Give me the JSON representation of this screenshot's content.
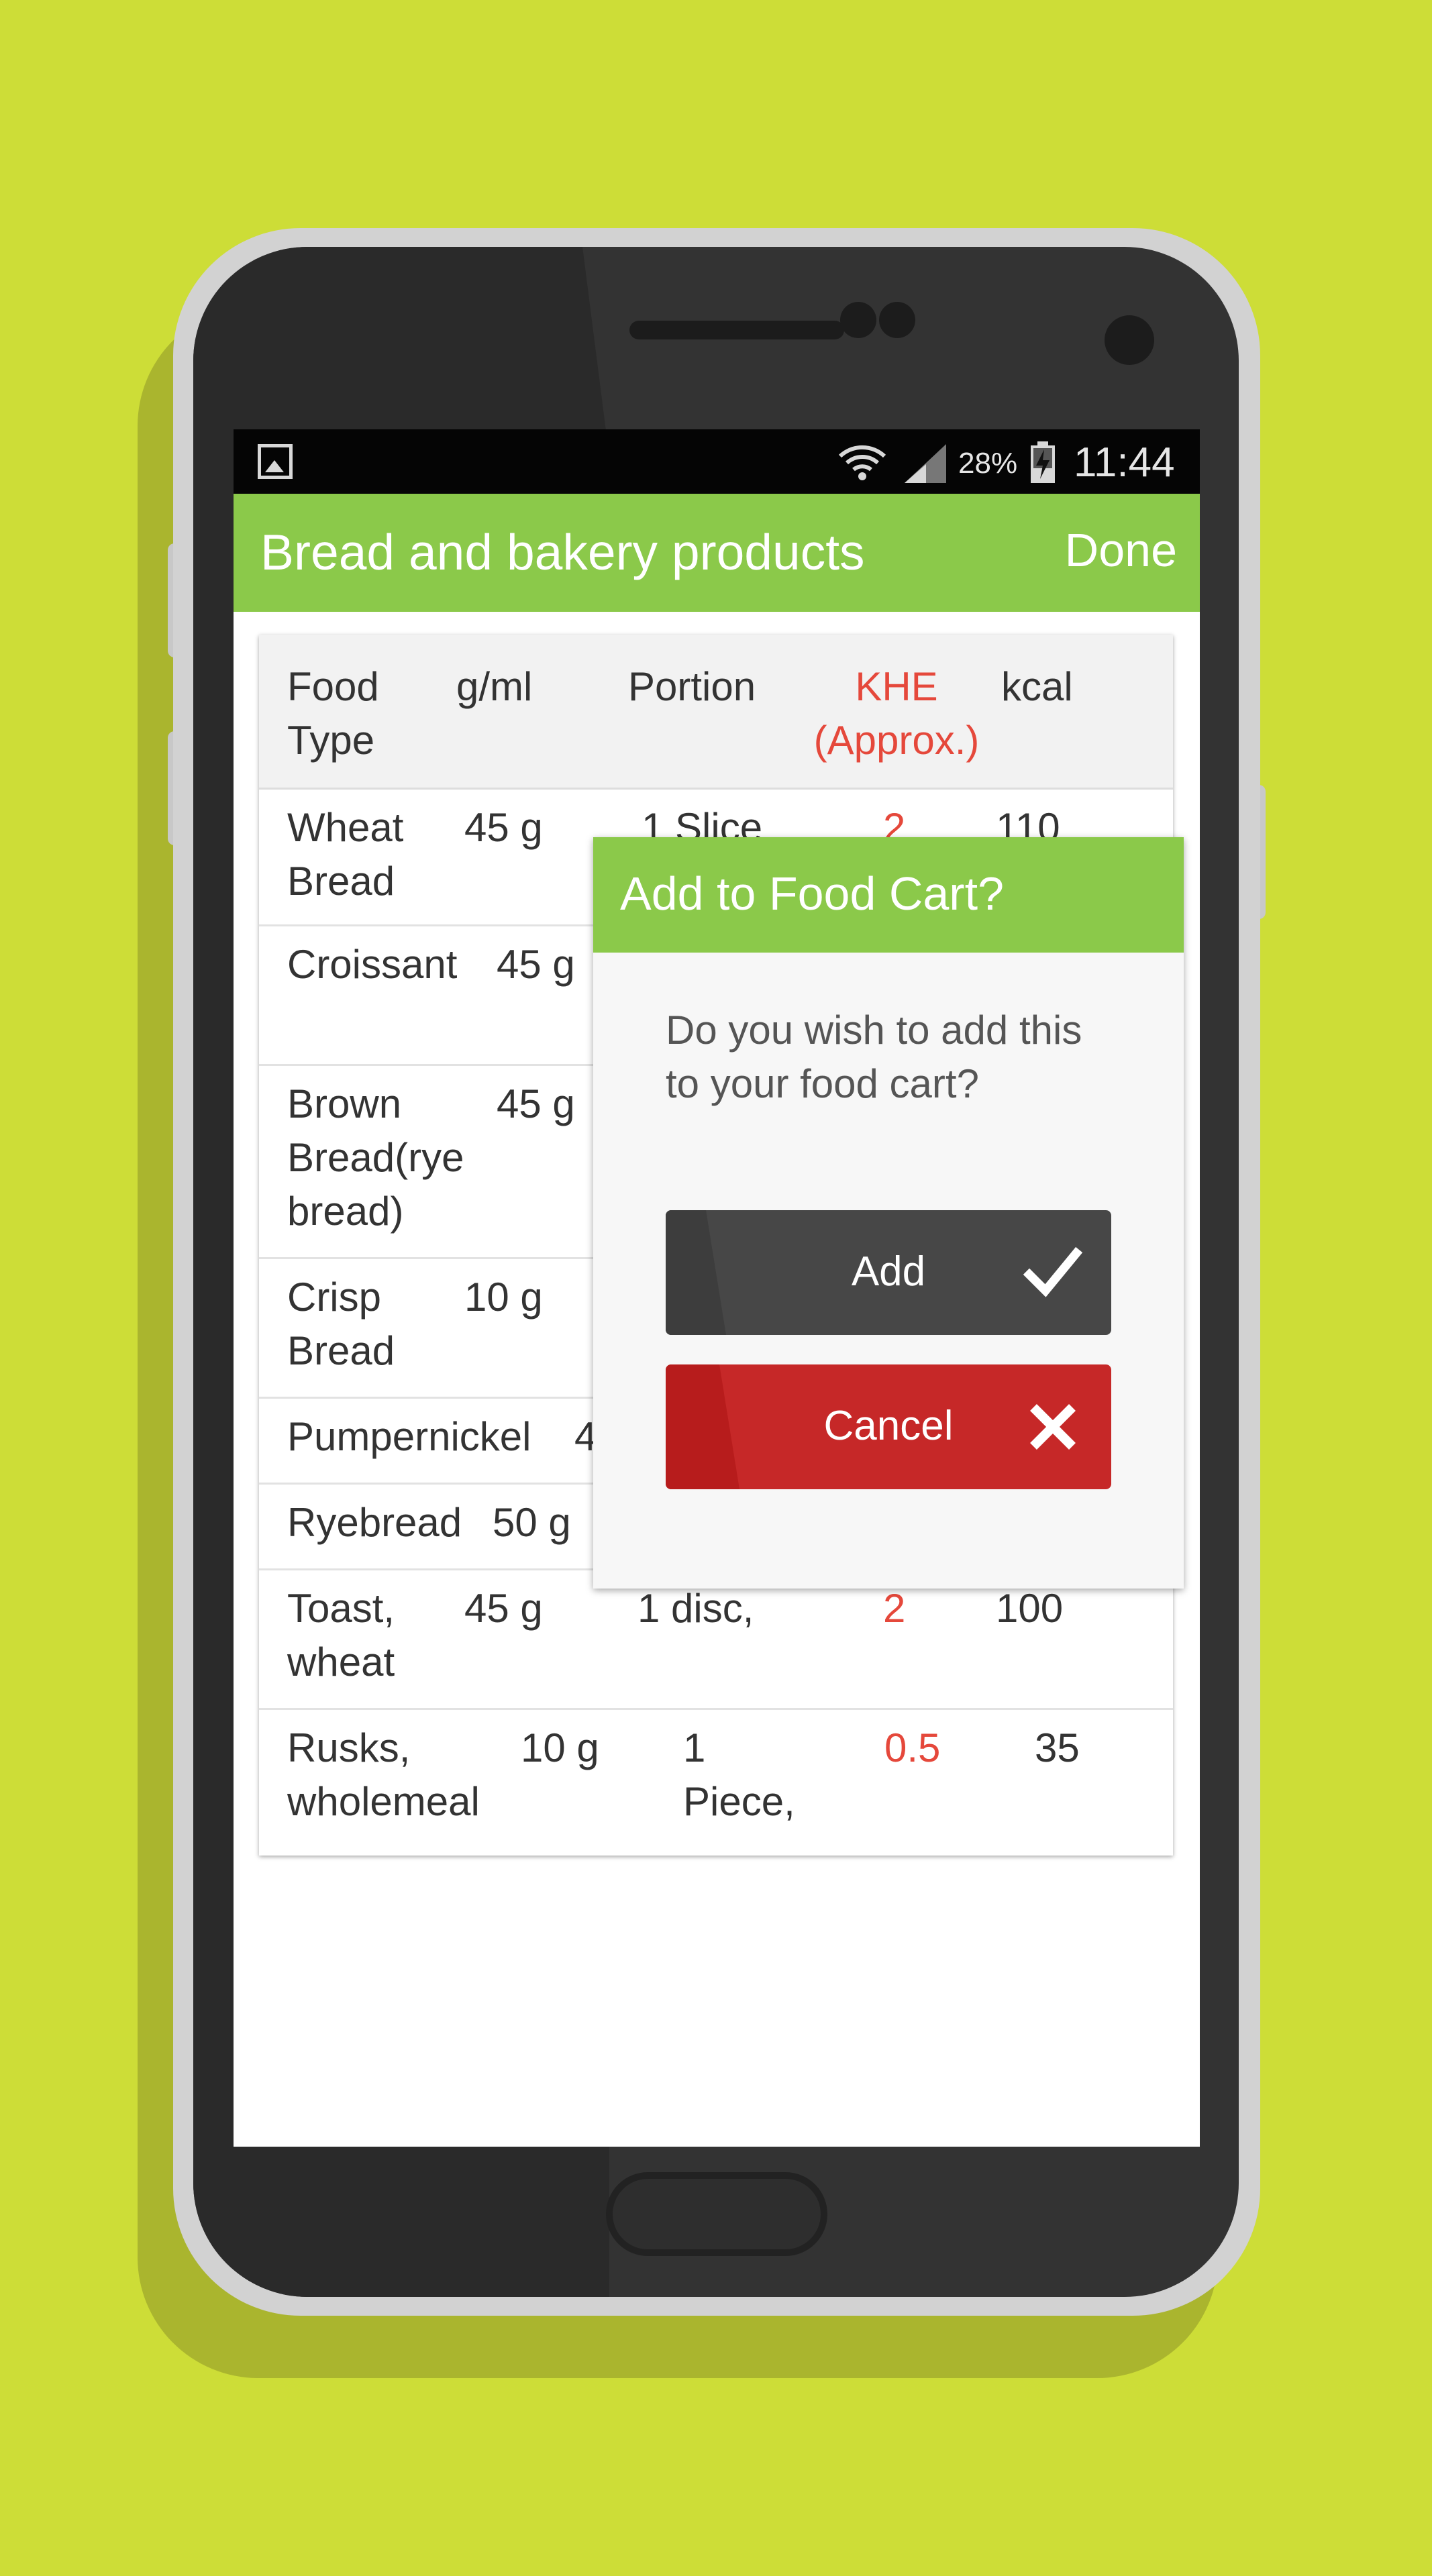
{
  "status_bar": {
    "battery_percent": "28%",
    "time": "11:44"
  },
  "app_bar": {
    "title": "Bread and bakery products",
    "done_label": "Done"
  },
  "table": {
    "headers": {
      "food_type": [
        "Food",
        "Type"
      ],
      "g_ml": "g/ml",
      "portion": "Portion",
      "khe": [
        "KHE",
        "(Approx.)"
      ],
      "kcal": "kcal"
    },
    "rows": [
      {
        "food": [
          "Wheat",
          "Bread"
        ],
        "gml": "45 g",
        "portion": [
          "1 Slice"
        ],
        "khe": "2",
        "kcal": "110"
      },
      {
        "food": [
          "Croissant"
        ],
        "gml": "45 g",
        "portion": [],
        "khe": "",
        "kcal": ""
      },
      {
        "food": [
          "Brown",
          "Bread(rye",
          "bread)"
        ],
        "gml": "45 g",
        "portion": [],
        "khe": "",
        "kcal": ""
      },
      {
        "food": [
          "Crisp",
          "Bread"
        ],
        "gml": "10 g",
        "portion": [],
        "khe": "",
        "kcal": ""
      },
      {
        "food": [
          "Pumpernickel"
        ],
        "gml": "4",
        "portion": [],
        "khe": "",
        "kcal": ""
      },
      {
        "food": [
          "Ryebread"
        ],
        "gml": "50 g",
        "portion": [],
        "khe": "",
        "kcal": ""
      },
      {
        "food": [
          "Toast,",
          "wheat"
        ],
        "gml": "45 g",
        "portion": [
          "1 disc,"
        ],
        "khe": "2",
        "kcal": "100"
      },
      {
        "food": [
          "Rusks,",
          "wholemeal"
        ],
        "gml": "10 g",
        "portion": [
          "1",
          "Piece,"
        ],
        "khe": "0.5",
        "kcal": "35"
      }
    ]
  },
  "dialog": {
    "title": "Add to Food Cart?",
    "message": [
      "Do you wish to add this",
      "to your food cart?"
    ],
    "add_label": "Add",
    "cancel_label": "Cancel"
  },
  "colors": {
    "background": "#cddd37",
    "accent_green": "#8bc94a",
    "khe_red": "#e5483b",
    "add_button": "#474747",
    "cancel_button": "#c62828"
  }
}
